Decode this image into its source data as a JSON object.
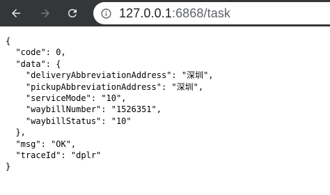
{
  "browser": {
    "url_host": "127.0.0.1",
    "url_rest": ":6868/task",
    "icons": {
      "back": "arrow-left-icon",
      "forward": "arrow-right-icon",
      "reload": "reload-icon",
      "site_info": "info-icon"
    },
    "colors": {
      "toolbar": "#35363a",
      "omnibox": "#ffffff",
      "icon_active": "#e8eaed",
      "icon_disabled": "#7b7c80"
    }
  },
  "response": {
    "lines": [
      "{",
      "  \"code\": 0,",
      "  \"data\": {",
      "    \"deliveryAbbreviationAddress\": \"深圳\",",
      "    \"pickupAbbreviationAddress\": \"深圳\",",
      "    \"serviceMode\": \"10\",",
      "    \"waybillNumber\": \"1526351\",",
      "    \"waybillStatus\": \"10\"",
      "  },",
      "  \"msg\": \"OK\",",
      "  \"traceId\": \"dplr\"",
      "}"
    ]
  }
}
